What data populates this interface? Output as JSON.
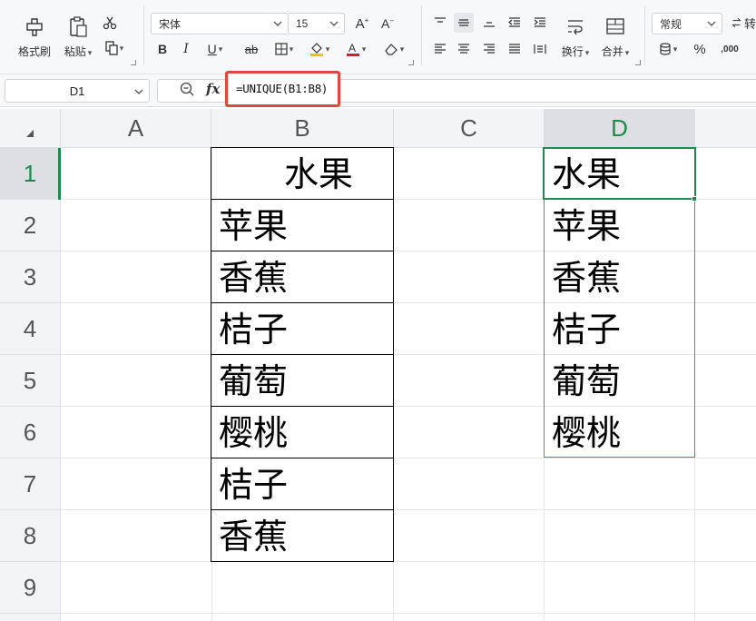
{
  "ribbon": {
    "format_painter": "格式刷",
    "paste": "粘贴",
    "font_name": "宋体",
    "font_size": "15",
    "wrap": "换行",
    "merge": "合并",
    "number_format": "常规",
    "percent": "%",
    "thousands": ",000",
    "partial_right_label": "转"
  },
  "formula_bar": {
    "name_box": "D1",
    "fx": "fx",
    "formula": "=UNIQUE(B1:B8)"
  },
  "columns": [
    "A",
    "B",
    "C",
    "D"
  ],
  "rows": [
    "1",
    "2",
    "3",
    "4",
    "5",
    "6",
    "7",
    "8",
    "9"
  ],
  "column_b": [
    "水果",
    "苹果",
    "香蕉",
    "桔子",
    "葡萄",
    "樱桃",
    "桔子",
    "香蕉"
  ],
  "column_d": [
    "水果",
    "苹果",
    "香蕉",
    "桔子",
    "葡萄",
    "樱桃"
  ],
  "colors": {
    "accent_green": "#1e8a4f",
    "highlight_red": "#e0473f",
    "range_blue": "#4a86c8"
  }
}
